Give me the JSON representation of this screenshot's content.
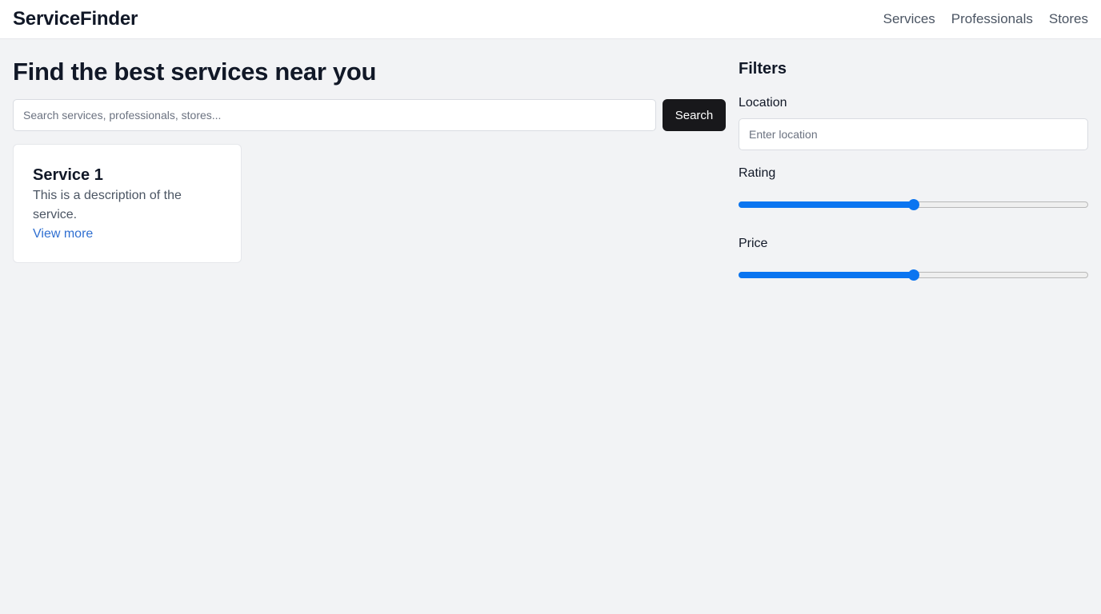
{
  "header": {
    "brand": "ServiceFinder",
    "nav": [
      "Services",
      "Professionals",
      "Stores"
    ]
  },
  "main": {
    "title": "Find the best services near you",
    "search_placeholder": "Search services, professionals, stores...",
    "search_button": "Search",
    "cards": [
      {
        "title": "Service 1",
        "description": "This is a description of the service.",
        "link": "View more"
      }
    ]
  },
  "filters": {
    "title": "Filters",
    "location_label": "Location",
    "location_placeholder": "Enter location",
    "rating_label": "Rating",
    "rating_value": 0.5,
    "price_label": "Price",
    "price_value": 0.5
  },
  "colors": {
    "accent": "#0b75f0",
    "link": "#2f6fd1",
    "button": "#18181b",
    "background": "#f2f3f5"
  }
}
